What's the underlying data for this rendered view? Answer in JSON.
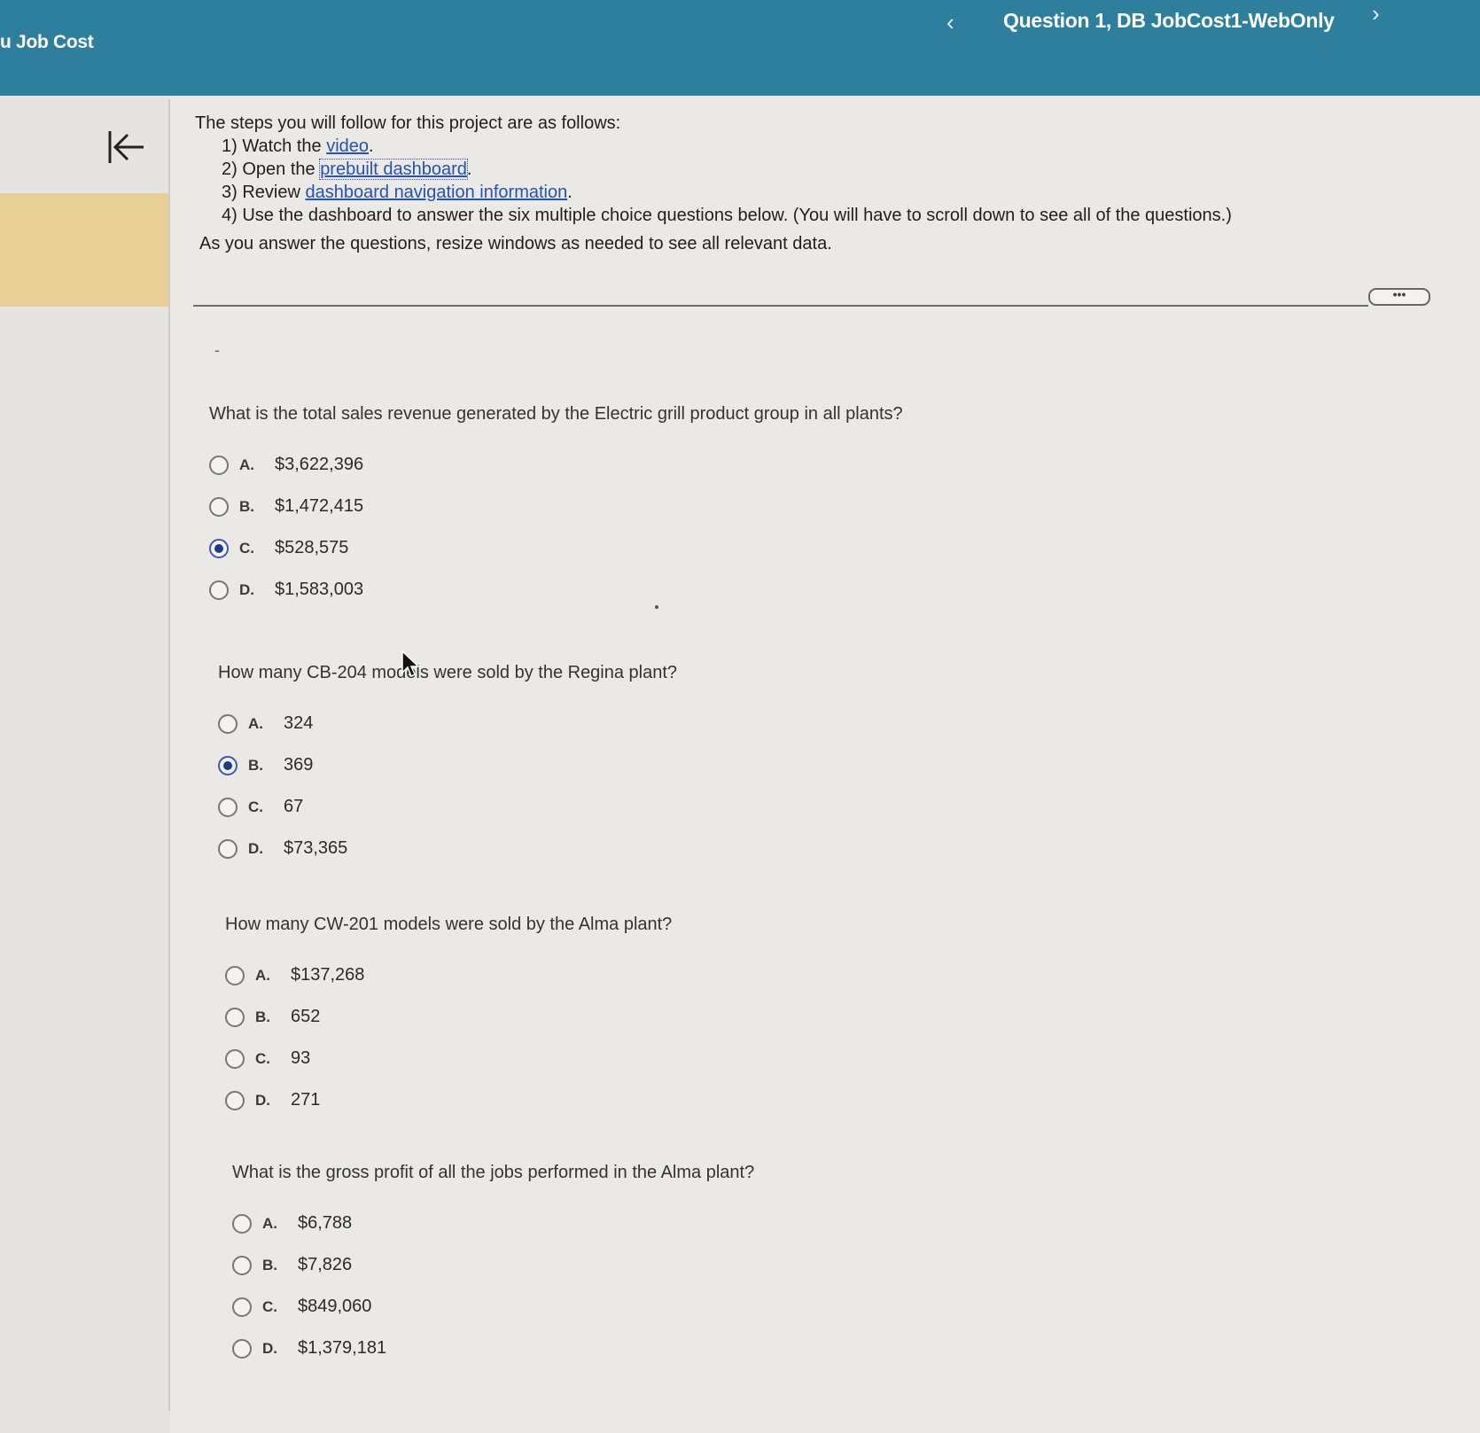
{
  "header": {
    "app_title": "u Job Cost",
    "question_title": "Question 1, DB JobCost1-WebOnly",
    "prev_label": "‹",
    "next_label": "›"
  },
  "sidebar": {
    "collapse_icon": "collapse-left-icon"
  },
  "instructions": {
    "intro": "The steps you will follow for this project are as follows:",
    "step1_prefix": "1) Watch the ",
    "step1_link": "video",
    "step1_suffix": ".",
    "step2_prefix": "2) Open the ",
    "step2_link": "prebuilt dashboard",
    "step2_suffix": ".",
    "step3_prefix": "3) Review ",
    "step3_link": "dashboard navigation information",
    "step3_suffix": ".",
    "step4": "4) Use the dashboard to answer the six multiple choice questions below. (You will have to scroll down to see all of the questions.)",
    "note": "As you answer the questions, resize windows as needed to see all relevant data."
  },
  "more_button_label": "•••",
  "dash_mark": "-",
  "questions": [
    {
      "prompt": "What is the total sales revenue generated by the Electric grill product group in all plants?",
      "options": [
        {
          "letter": "A.",
          "value": "$3,622,396"
        },
        {
          "letter": "B.",
          "value": "$1,472,415"
        },
        {
          "letter": "C.",
          "value": "$528,575"
        },
        {
          "letter": "D.",
          "value": "$1,583,003"
        }
      ],
      "selected": 2
    },
    {
      "prompt": "How many CB-204 models were sold by the Regina plant?",
      "options": [
        {
          "letter": "A.",
          "value": "324"
        },
        {
          "letter": "B.",
          "value": "369"
        },
        {
          "letter": "C.",
          "value": "67"
        },
        {
          "letter": "D.",
          "value": "$73,365"
        }
      ],
      "selected": 1
    },
    {
      "prompt": "How many CW-201 models were sold by the Alma plant?",
      "options": [
        {
          "letter": "A.",
          "value": "$137,268"
        },
        {
          "letter": "B.",
          "value": "652"
        },
        {
          "letter": "C.",
          "value": "93"
        },
        {
          "letter": "D.",
          "value": "271"
        }
      ],
      "selected": null
    },
    {
      "prompt": "What is the gross profit of all the jobs performed in the Alma plant?",
      "options": [
        {
          "letter": "A.",
          "value": "$6,788"
        },
        {
          "letter": "B.",
          "value": "$7,826"
        },
        {
          "letter": "C.",
          "value": "$849,060"
        },
        {
          "letter": "D.",
          "value": "$1,379,181"
        }
      ],
      "selected": null
    }
  ],
  "colors": {
    "header_bg": "#2d7f9d",
    "rail_highlight": "#e7cf95",
    "link": "#2651b5",
    "radio_selected": "#1e3c86"
  }
}
